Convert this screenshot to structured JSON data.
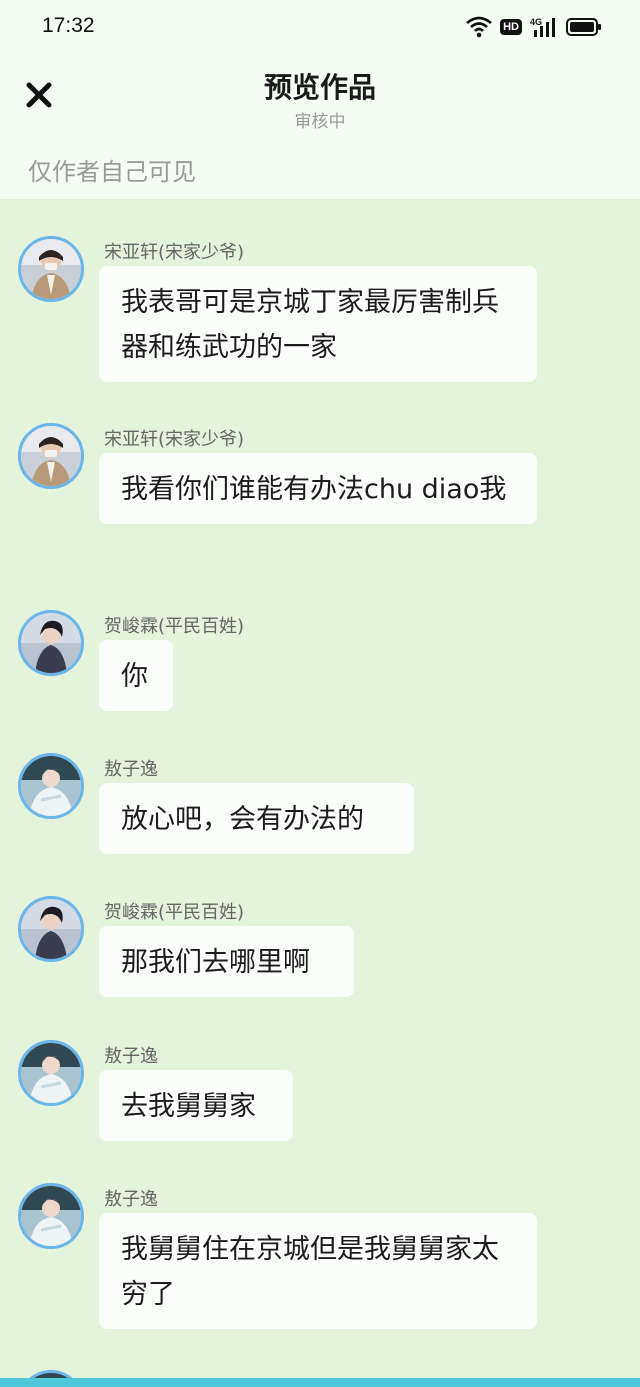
{
  "status_bar": {
    "time": "17:32",
    "icons": [
      "wifi-icon",
      "hd-icon",
      "4g-signal-icon",
      "battery-icon"
    ],
    "hd_label": "HD",
    "network_label": "4G"
  },
  "header": {
    "close_icon": "close-icon",
    "title": "预览作品",
    "subtitle": "审核中",
    "notice": "仅作者自己可见"
  },
  "messages": [
    {
      "sender": "宋亚轩(宋家少爷)",
      "avatar": "avatar-songyaxuan",
      "text": "我表哥可是京城丁家最厉害制兵器和练武功的一家"
    },
    {
      "sender": "宋亚轩(宋家少爷)",
      "avatar": "avatar-songyaxuan",
      "text": "我看你们谁能有办法chu diao我"
    },
    {
      "sender": "贺峻霖(平民百姓)",
      "avatar": "avatar-hejunlin",
      "text": "你"
    },
    {
      "sender": "敖子逸",
      "avatar": "avatar-aoziyi",
      "text": "放心吧，会有办法的"
    },
    {
      "sender": "贺峻霖(平民百姓)",
      "avatar": "avatar-hejunlin",
      "text": "那我们去哪里啊"
    },
    {
      "sender": "敖子逸",
      "avatar": "avatar-aoziyi",
      "text": "去我舅舅家"
    },
    {
      "sender": "敖子逸",
      "avatar": "avatar-aoziyi",
      "text": "我舅舅住在京城但是我舅舅家太穷了"
    }
  ],
  "colors": {
    "chat_background": "#e4f3dc",
    "header_background": "#f4fcf4",
    "avatar_ring": "#6ab6e8",
    "bottom_bar": "#4fc6d9"
  }
}
